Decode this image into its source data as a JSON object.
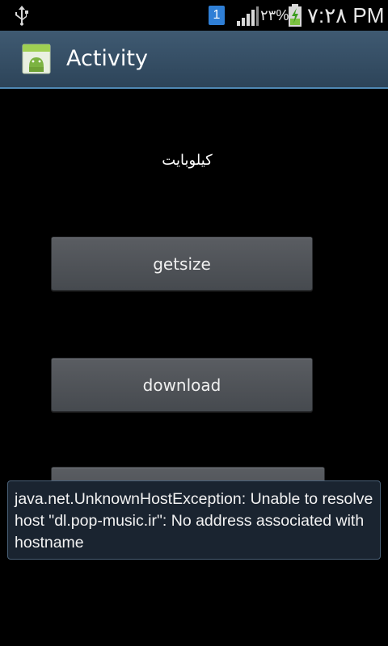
{
  "status_bar": {
    "notification_badge": "1",
    "battery_percent": "٢٣%",
    "time": "٧:٢٨ PM",
    "icons": [
      "usb-icon",
      "notification-icon",
      "signal-icon",
      "battery-charging-icon"
    ]
  },
  "action_bar": {
    "title": "Activity",
    "icon": "android-app-icon"
  },
  "content": {
    "size_label": "کیلوبایت",
    "getsize_button": "getsize",
    "download_button": "download",
    "third_button": ""
  },
  "toast": {
    "message": "java.net.UnknownHostException: Unable to resolve host \"dl.pop-music.ir\": No address associated with hostname"
  },
  "colors": {
    "action_bar": "#35506a",
    "button": "#505459",
    "toast_border": "#4a6178"
  }
}
